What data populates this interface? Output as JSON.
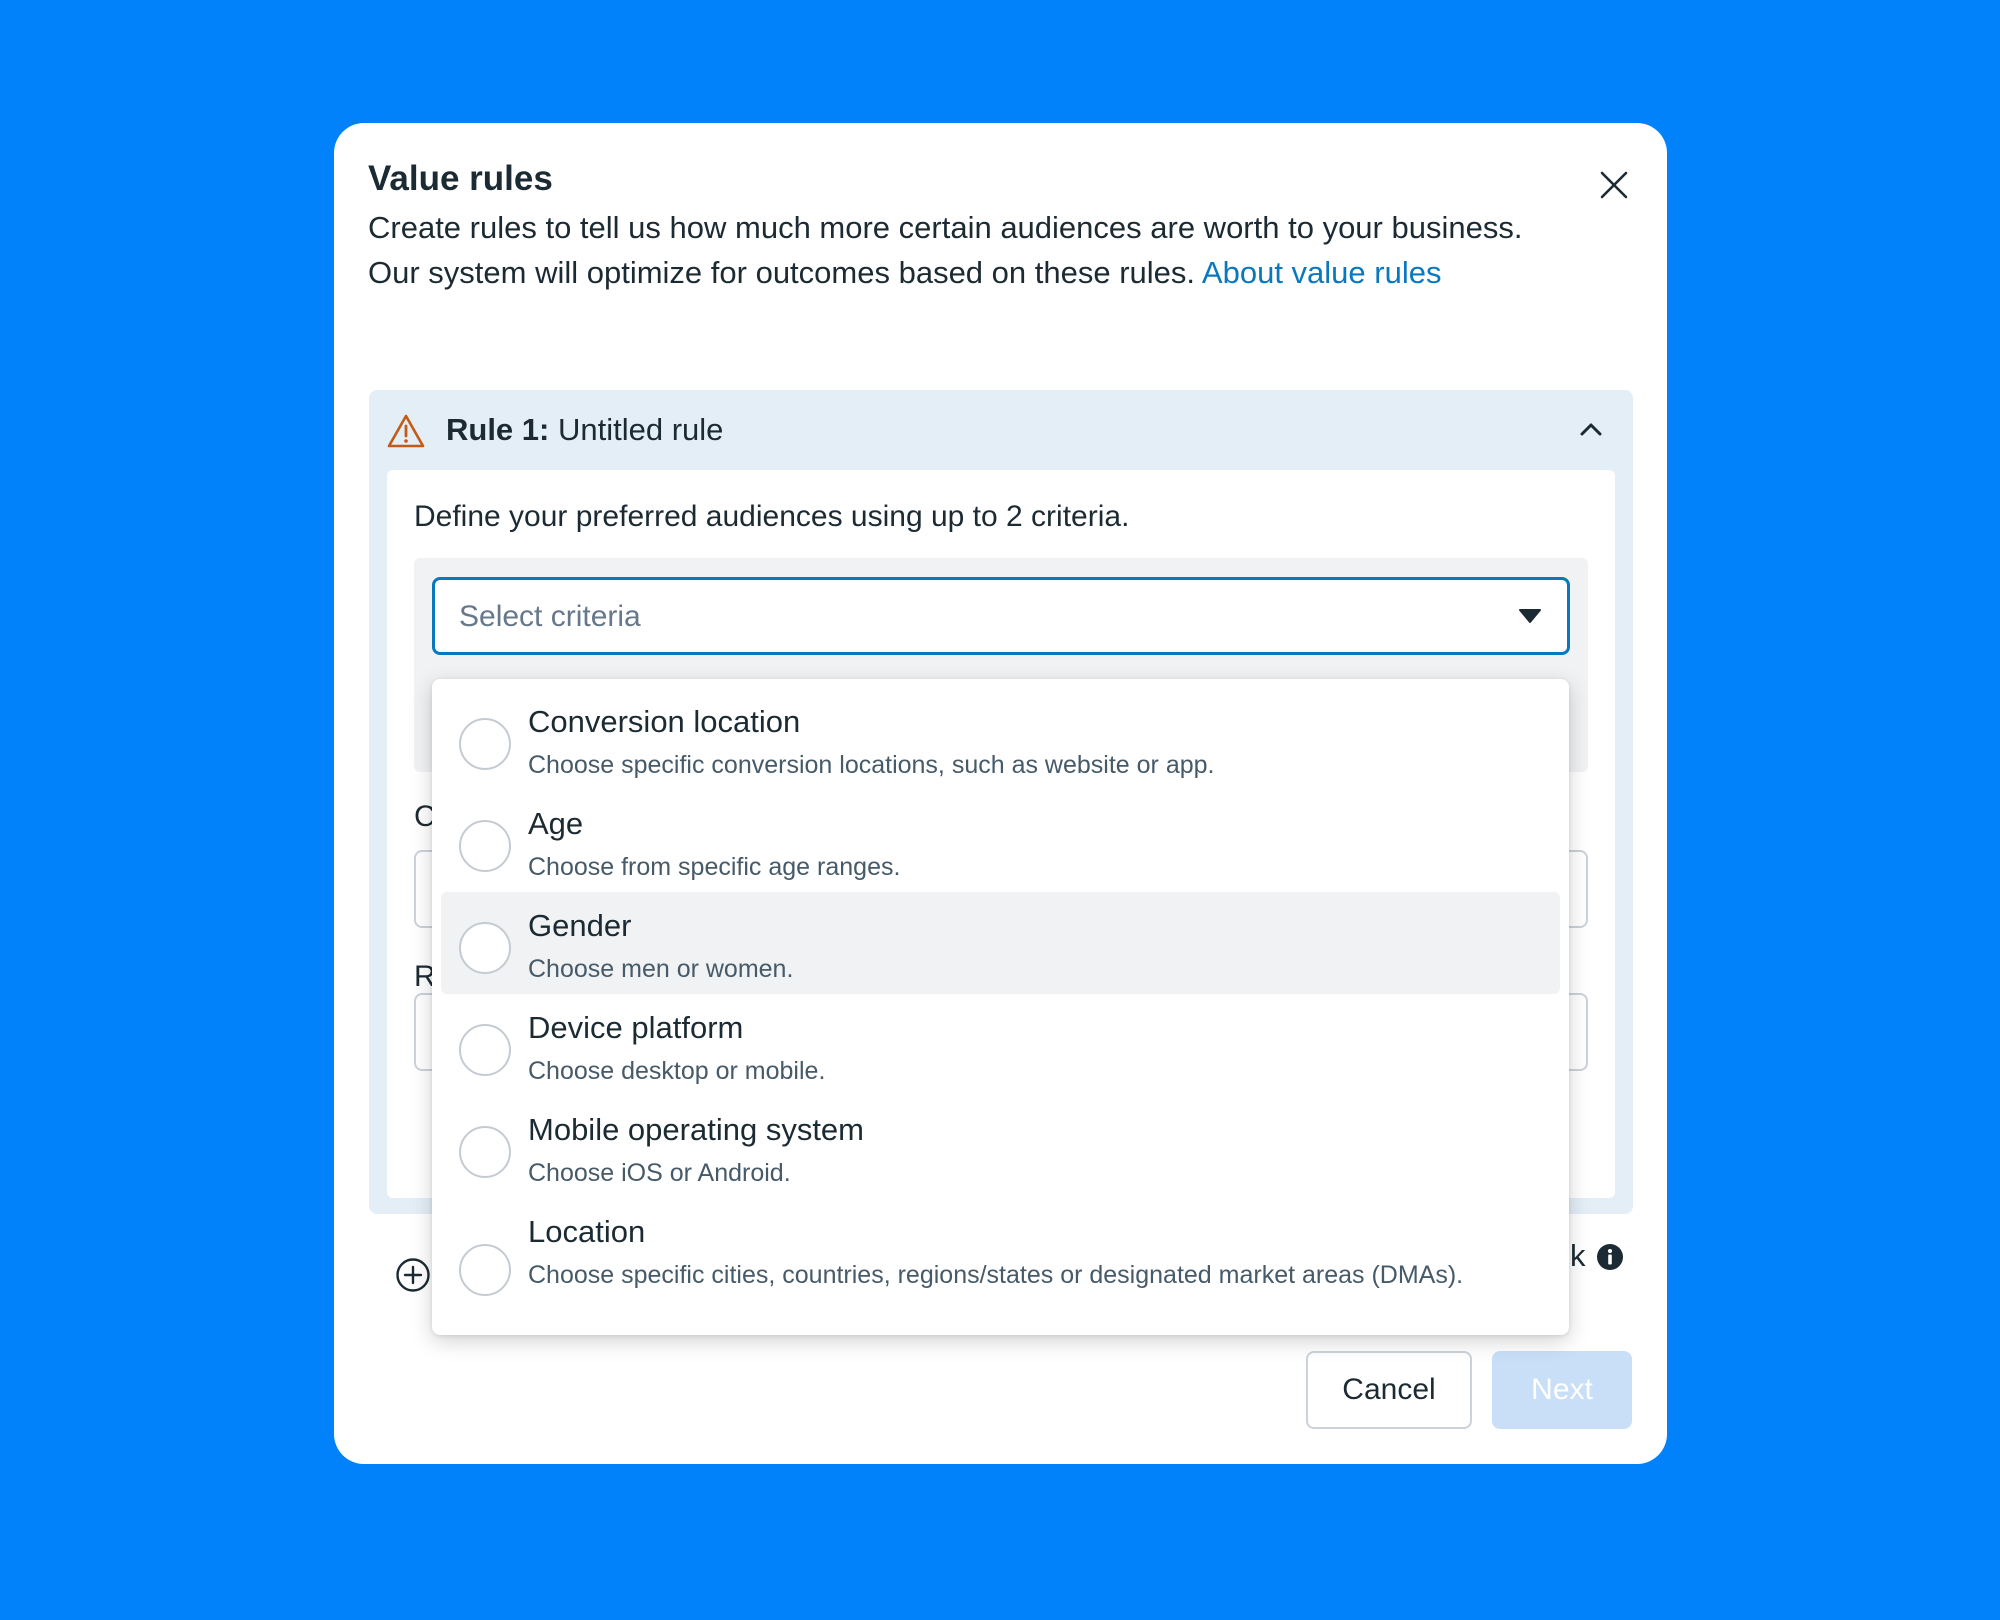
{
  "modal": {
    "title": "Value rules",
    "description": "Create rules to tell us how much more certain audiences are worth to your business. Our system will optimize for outcomes based on these rules. ",
    "about_link": "About value rules"
  },
  "rule": {
    "number_label": "Rule 1:",
    "name": " Untitled rule",
    "define_text": "Define your preferred audiences using up to 2 criteria.",
    "select_placeholder": "Select criteria",
    "peek_letter_1": "C",
    "peek_letter_2": "R"
  },
  "footer": {
    "peek_text": "k",
    "cancel_label": "Cancel",
    "next_label": "Next"
  },
  "dropdown": {
    "options": [
      {
        "label": "Conversion location",
        "description": "Choose specific conversion locations, such as website or app."
      },
      {
        "label": "Age",
        "description": "Choose from specific age ranges."
      },
      {
        "label": "Gender",
        "description": "Choose men or women."
      },
      {
        "label": "Device platform",
        "description": "Choose desktop or mobile."
      },
      {
        "label": "Mobile operating system",
        "description": "Choose iOS or Android."
      },
      {
        "label": "Location",
        "description": "Choose specific cities, countries, regions/states or designated market areas (DMAs)."
      }
    ],
    "highlighted_index": 2
  },
  "colors": {
    "background": "#0282FA",
    "link": "#0A78BE",
    "warning": "#C15B16",
    "panel": "#E4EEF7",
    "next_disabled": "#C8DFF7"
  }
}
